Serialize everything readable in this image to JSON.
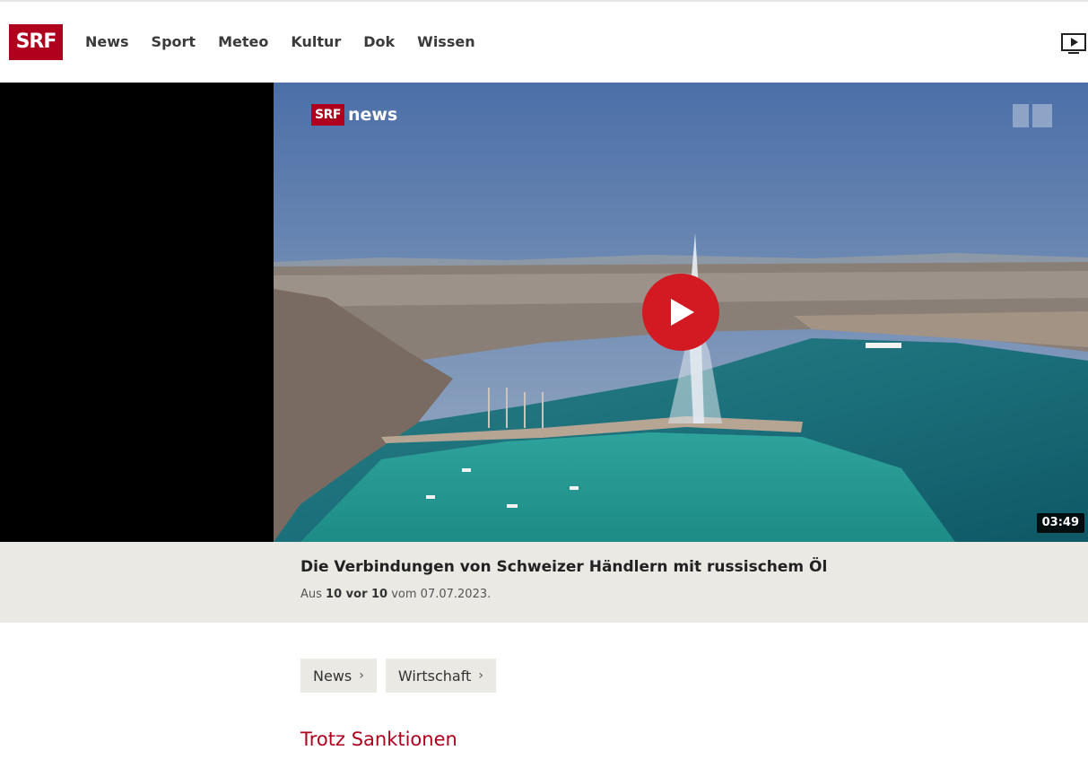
{
  "header": {
    "logo_text": "SRF",
    "nav": [
      "News",
      "Sport",
      "Meteo",
      "Kultur",
      "Dok",
      "Wissen"
    ]
  },
  "player": {
    "brand_box": "SRF",
    "brand_word": "news",
    "duration": "03:49"
  },
  "caption": {
    "title": "Die Verbindungen von Schweizer Händlern mit russischem Öl",
    "meta_prefix": "Aus ",
    "meta_show": "10 vor 10",
    "meta_suffix": " vom 07.07.2023."
  },
  "tags": [
    "News",
    "Wirtschaft"
  ],
  "article": {
    "kicker": "Trotz Sanktionen"
  },
  "colors": {
    "brand": "#af001e",
    "play": "#d31a22",
    "strip": "#eae9e4"
  }
}
